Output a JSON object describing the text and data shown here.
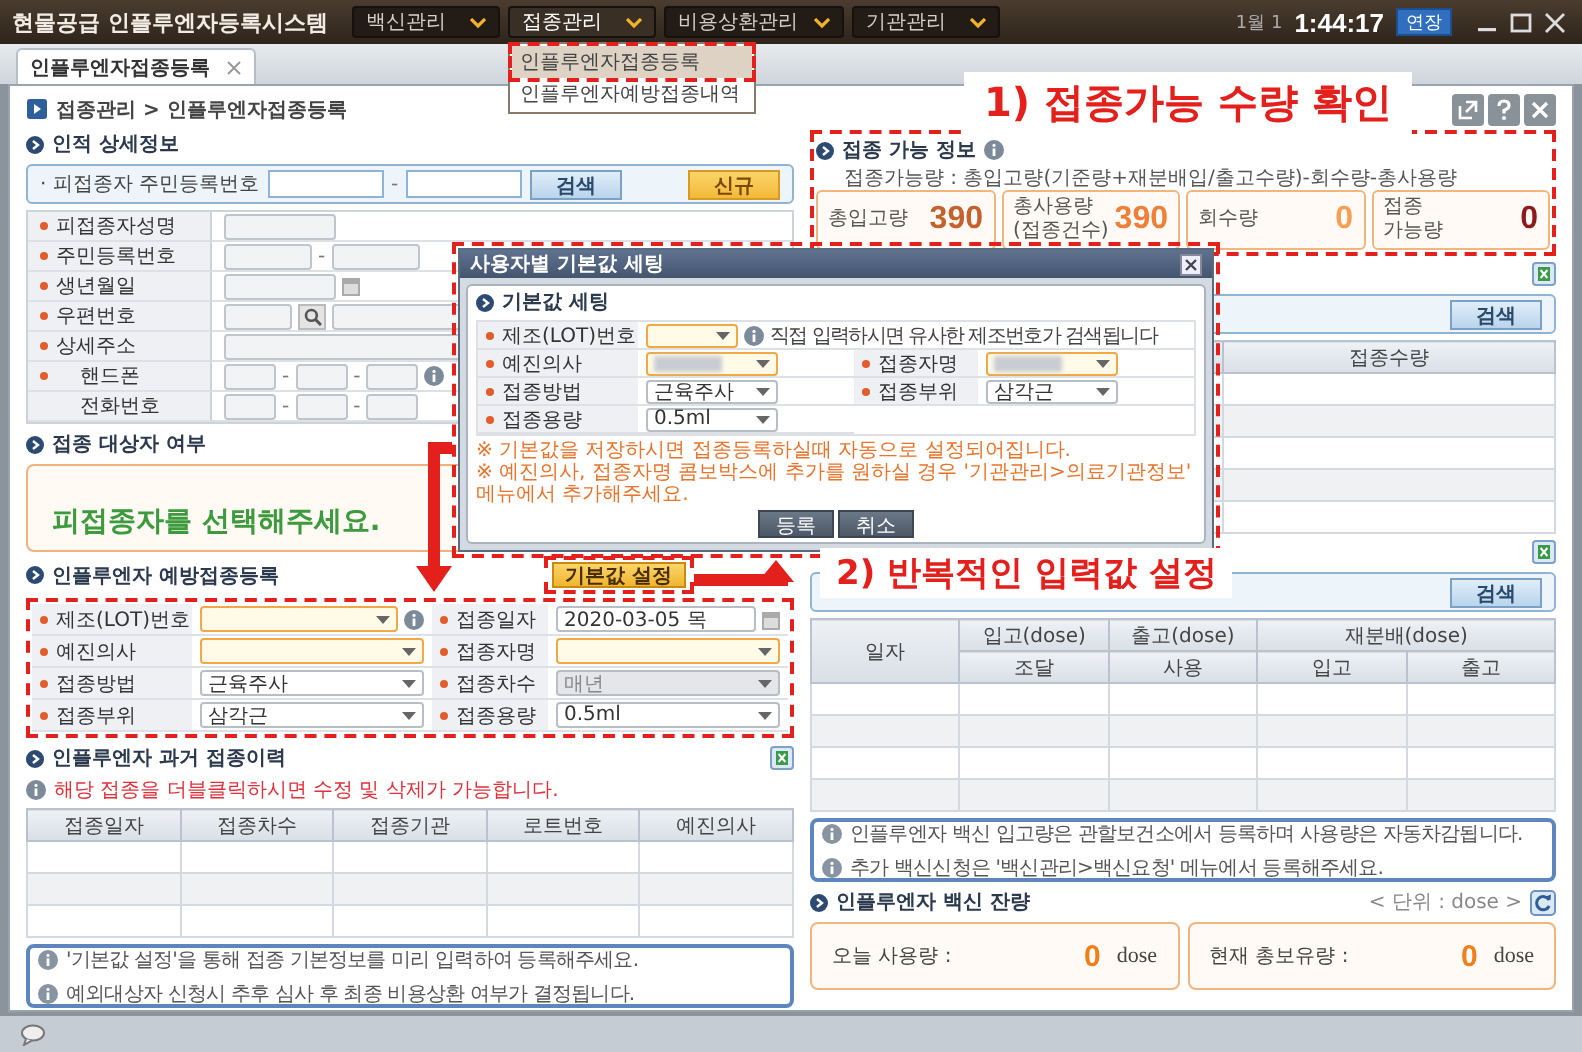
{
  "title_bar": {
    "app_title": "현물공급 인플루엔자등록시스템",
    "menus": [
      {
        "label": "백신관리",
        "selected": false
      },
      {
        "label": "접종관리",
        "selected": true
      },
      {
        "label": "비용상환관리",
        "selected": false
      },
      {
        "label": "기관관리",
        "selected": false
      }
    ],
    "date": "1월 1",
    "time": "1:44:17",
    "extend_button": "연장"
  },
  "menu_dropdown": {
    "items": [
      {
        "label": "인플루엔자접종등록",
        "selected": true
      },
      {
        "label": "인플루엔자예방접종내역",
        "selected": false
      }
    ]
  },
  "tabs": [
    {
      "label": "인플루엔자접종등록",
      "selected": true
    }
  ],
  "breadcrumb": "접종관리 > 인플루엔자접종등록",
  "annotations": [
    "1) 접종가능 수량 확인",
    "2) 반복적인 입력값 설정"
  ],
  "personal_info": {
    "title": "인적 상세정보",
    "search_label": "· 피접종자 주민등록번호",
    "separator": "-",
    "search_button": "검색",
    "new_button": "신규",
    "fields": [
      {
        "label": "피접종자성명",
        "kind": "single",
        "required": true
      },
      {
        "label": "주민등록번호",
        "kind": "split",
        "required": true
      },
      {
        "label": "생년월일",
        "kind": "date",
        "required": true
      },
      {
        "label": "우편번호",
        "kind": "zip",
        "required": true
      },
      {
        "label": "상세주소",
        "kind": "wide",
        "required": true
      },
      {
        "label": "핸드폰",
        "kind": "phone",
        "required": true,
        "hint_icon": true
      },
      {
        "label": "전화번호",
        "kind": "phone",
        "required": false
      }
    ]
  },
  "target": {
    "title": "접종 대상자 여부",
    "message": "피접종자를 선택해주세요."
  },
  "registration": {
    "title": "인플루엔자 예방접종등록",
    "default_button": "기본값 설정",
    "fields": [
      {
        "label": "제조(LOT)번호",
        "kind": "select",
        "disabled": false,
        "hint_icon": true
      },
      {
        "label": "접종일자",
        "value": "2020-03-05 목",
        "kind": "date",
        "disabled": false
      },
      {
        "label": "예진의사",
        "kind": "select",
        "disabled": false
      },
      {
        "label": "접종자명",
        "kind": "select",
        "disabled": false
      },
      {
        "label": "접종방법",
        "value": "근육주사",
        "kind": "select",
        "disabled": false
      },
      {
        "label": "접종차수",
        "value": "매년",
        "kind": "select",
        "disabled": true
      },
      {
        "label": "접종부위",
        "value": "삼각근",
        "kind": "select",
        "disabled": false
      },
      {
        "label": "접종용량",
        "value": "0.5ml",
        "kind": "select",
        "disabled": false
      }
    ]
  },
  "history": {
    "title": "인플루엔자 과거 접종이력",
    "hint": "해당 접종을 더블클릭하시면 수정 및 삭제가 가능합니다.",
    "columns": [
      "접종일자",
      "접종차수",
      "접종기관",
      "로트번호",
      "예진의사"
    ]
  },
  "notes_left": [
    "'기본값 설정'을 통해 접종 기본정보를 미리 입력하여 등록해주세요.",
    "예외대상자 신청시 추후 심사 후 최종 비용상환 여부가 결정됩니다."
  ],
  "availability": {
    "title": "접종 가능 정보",
    "formula": "접종가능량 : 총입고량(기준량+재분배입/출고수량)-회수량-총사용량",
    "cards": [
      {
        "label": [
          "총입고량"
        ],
        "value": "390",
        "color": "#c4622d"
      },
      {
        "label": [
          "총사용량",
          "(접종건수)"
        ],
        "value": "390",
        "color": "#f07f3a"
      },
      {
        "label": [
          "회수량"
        ],
        "value": "0",
        "color": "#f4a055"
      },
      {
        "label": [
          "접종",
          "가능량"
        ],
        "value": "0",
        "color": "#8e1b1b"
      }
    ]
  },
  "vaccine_list": {
    "search_button": "검색",
    "columns": [
      "접종수량"
    ]
  },
  "stock": {
    "search_button": "검색",
    "columns": [
      {
        "label": "일자"
      },
      {
        "label": "입고(dose)",
        "sub": [
          "조달"
        ]
      },
      {
        "label": "출고(dose)",
        "sub": [
          "사용"
        ]
      },
      {
        "label": "재분배(dose)",
        "sub": [
          "입고",
          "출고"
        ]
      }
    ]
  },
  "notes_right": [
    "인플루엔자 백신 입고량은 관할보건소에서 등록하며 사용량은 자동차감됩니다.",
    "추가 백신신청은 '백신관리>백신요청' 메뉴에서 등록해주세요."
  ],
  "remaining": {
    "title": "인플루엔자 백신 잔량",
    "unit_note": "< 단위 : dose >",
    "cards": [
      {
        "label": "오늘 사용량 :",
        "value": "0",
        "unit": "dose"
      },
      {
        "label": "현재 총보유량 :",
        "value": "0",
        "unit": "dose"
      }
    ]
  },
  "dialog": {
    "title": "사용자별 기본값 세팅",
    "section": "기본값 세팅",
    "lot": {
      "label": "제조(LOT)번호",
      "hint": "직접 입력하시면 유사한 제조번호가 검색됩니다"
    },
    "fields": [
      {
        "label": "예진의사",
        "redacted": true
      },
      {
        "label": "접종자명",
        "redacted": true
      },
      {
        "label": "접종방법",
        "value": "근육주사",
        "redacted": false
      },
      {
        "label": "접종부위",
        "value": "삼각근",
        "redacted": false
      },
      {
        "label": "접종용량",
        "value": "0.5ml",
        "redacted": false
      }
    ],
    "notes": [
      "※ 기본값을 저장하시면 접종등록하실때 자동으로 설정되어집니다.",
      "※ 예진의사, 접종자명 콤보박스에 추가를 원하실 경우 '기관관리>의료기관정보' 메뉴에서 추가해주세요."
    ],
    "buttons": [
      "등록",
      "취소"
    ]
  }
}
